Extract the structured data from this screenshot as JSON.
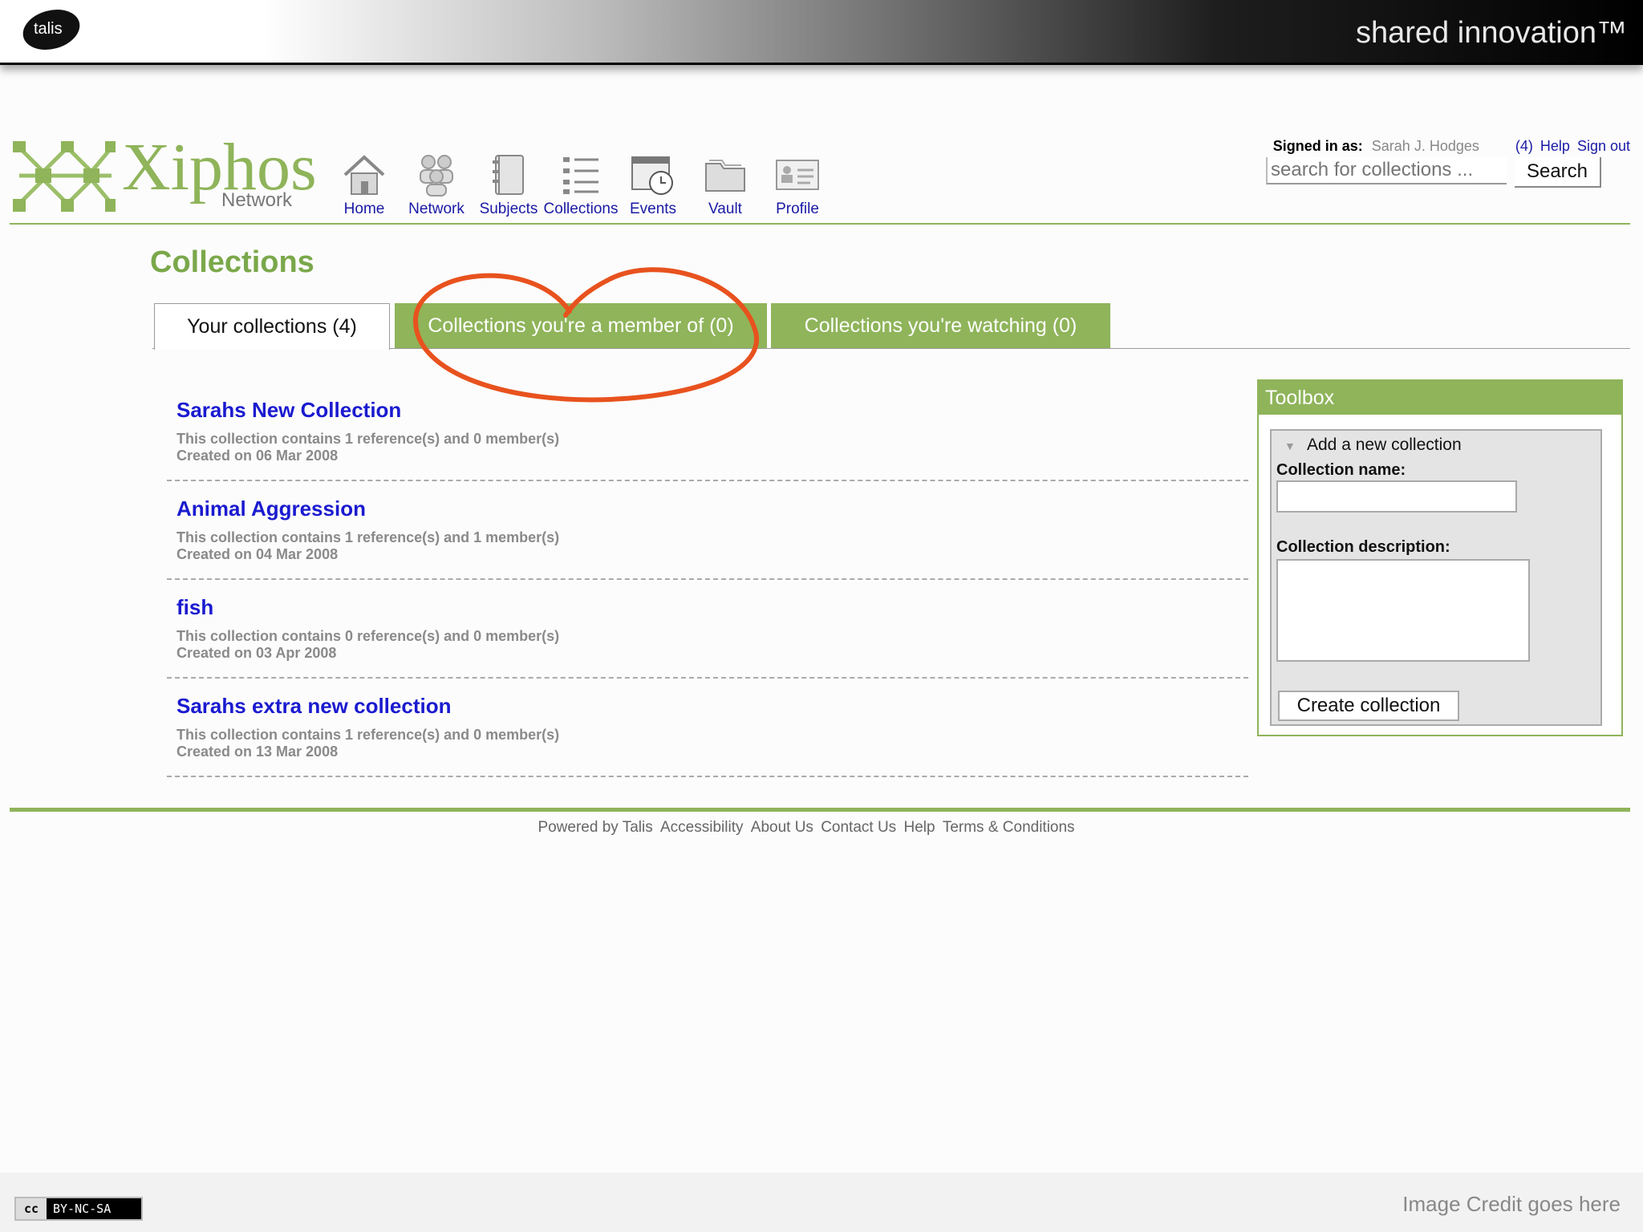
{
  "slide": {
    "brand_logo_text": "talis",
    "tagline": "shared innovation™",
    "license_badge": "BY-NC-SA",
    "license_cc": "cc",
    "image_credit": "Image Credit goes here"
  },
  "app": {
    "logo_text": "Xiphos",
    "logo_subtext": "Network",
    "nav": [
      {
        "label": "Home",
        "icon": "home-icon"
      },
      {
        "label": "Network",
        "icon": "people-icon"
      },
      {
        "label": "Subjects",
        "icon": "notebook-icon"
      },
      {
        "label": "Collections",
        "icon": "list-icon"
      },
      {
        "label": "Events",
        "icon": "calendar-clock-icon"
      },
      {
        "label": "Vault",
        "icon": "folder-icon"
      },
      {
        "label": "Profile",
        "icon": "profile-card-icon"
      }
    ],
    "signin": {
      "label": "Signed in as:",
      "user": "Sarah J. Hodges",
      "messages": "(4)",
      "help": "Help",
      "signout": "Sign out"
    },
    "search": {
      "placeholder": "search for collections ...",
      "button": "Search"
    }
  },
  "page": {
    "title": "Collections",
    "tabs": [
      {
        "label": "Your collections (4)",
        "active": true
      },
      {
        "label": "Collections you're a member of (0)",
        "active": false
      },
      {
        "label": "Collections you're watching (0)",
        "active": false
      }
    ],
    "annotation_color": "#e8521e"
  },
  "collections": [
    {
      "title": "Sarahs New Collection",
      "summary": "This collection contains 1 reference(s) and 0 member(s)",
      "created": "Created on 06 Mar 2008"
    },
    {
      "title": "Animal Aggression",
      "summary": "This collection contains 1 reference(s) and 1 member(s)",
      "created": "Created on 04 Mar 2008"
    },
    {
      "title": "fish",
      "summary": "This collection contains 0 reference(s) and 0 member(s)",
      "created": "Created on 03 Apr 2008"
    },
    {
      "title": "Sarahs extra new collection",
      "summary": "This collection contains 1 reference(s) and 0 member(s)",
      "created": "Created on 13 Mar 2008"
    }
  ],
  "toolbox": {
    "title": "Toolbox",
    "expander": "Add a new collection",
    "name_label": "Collection name:",
    "name_value": "",
    "desc_label": "Collection description:",
    "desc_value": "",
    "create_button": "Create collection"
  },
  "footer": {
    "links": [
      "Powered by Talis",
      "Accessibility",
      "About Us",
      "Contact Us",
      "Help",
      "Terms & Conditions"
    ]
  },
  "colors": {
    "accent_green": "#8fb45a",
    "link_blue": "#1a1ad0",
    "title_green": "#7aa84a"
  }
}
